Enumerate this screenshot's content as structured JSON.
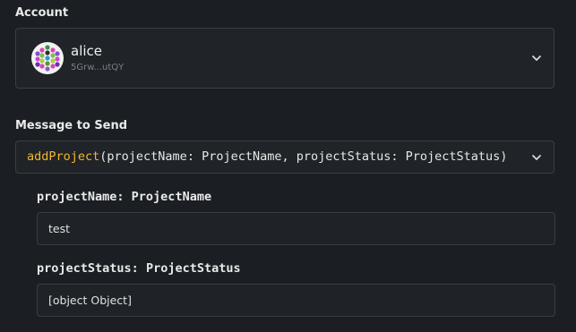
{
  "account": {
    "label": "Account",
    "name": "alice",
    "address": "5Grw...utQY",
    "avatar_icon": "identicon-icon",
    "dropdown_icon": "chevron-down-icon"
  },
  "message": {
    "label": "Message to Send",
    "function_name": "addProject",
    "signature": "(projectName: ProjectName, projectStatus: ProjectStatus)",
    "dropdown_icon": "chevron-down-icon"
  },
  "args": [
    {
      "name": "projectName",
      "type": "ProjectName",
      "value": "test"
    },
    {
      "name": "projectStatus",
      "type": "ProjectStatus",
      "value": "[object Object]"
    }
  ],
  "colors": {
    "background": "#1b1e22",
    "field_border": "#3a3e44",
    "function_accent": "#f2b62c"
  }
}
